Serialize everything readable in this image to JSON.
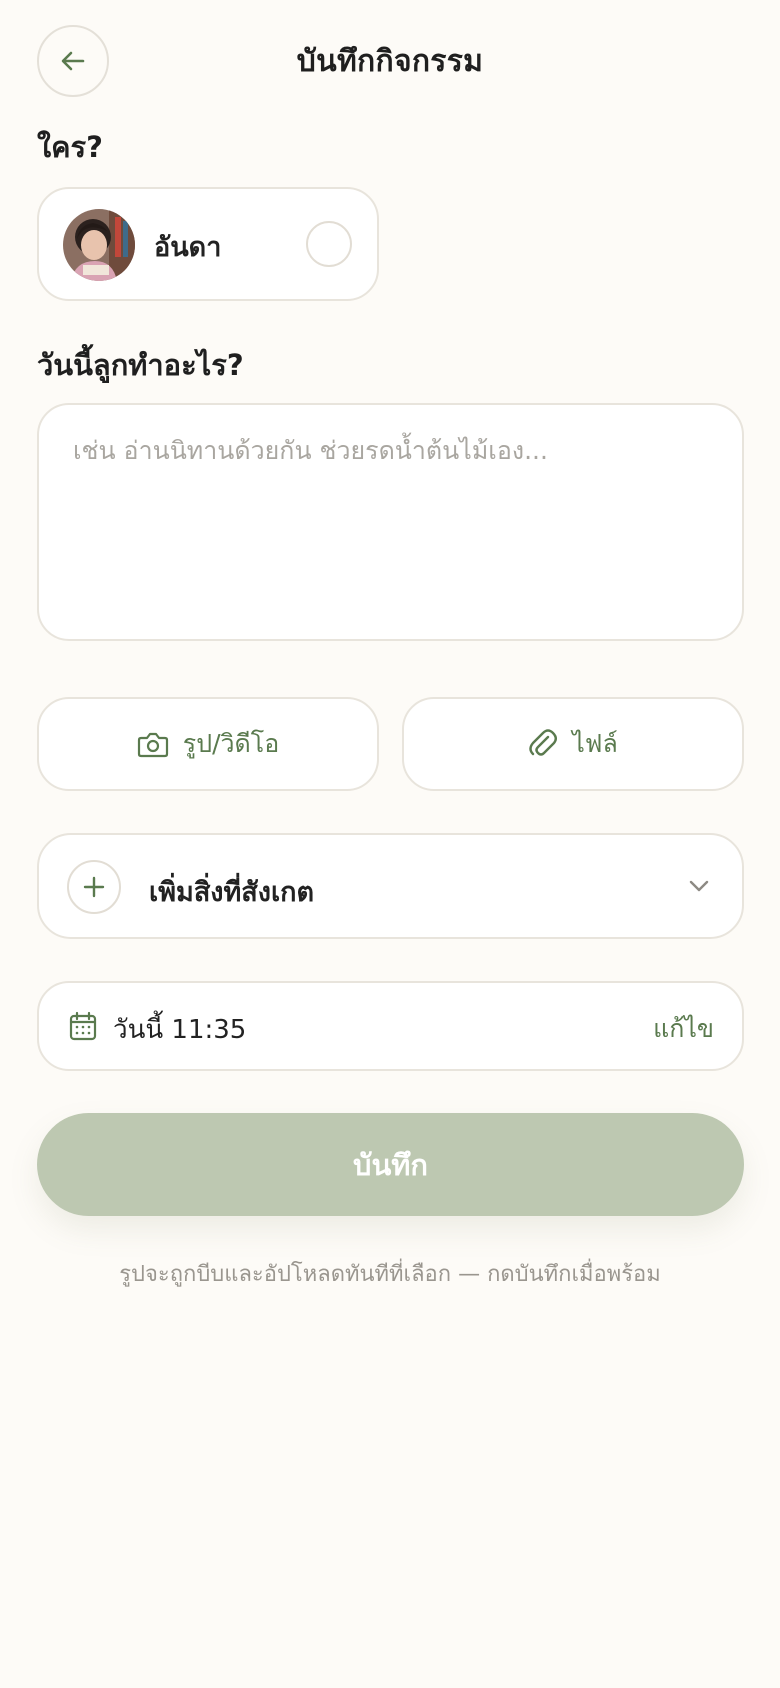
{
  "header": {
    "title": "บันทึกกิจกรรม",
    "back_icon": "arrow-left-icon"
  },
  "who": {
    "label": "ใคร?",
    "child": {
      "name": "อันดา",
      "selected": false
    }
  },
  "activity": {
    "label": "วันนี้ลูกทำอะไร?",
    "value": "",
    "placeholder": "เช่น อ่านนิทานด้วยกัน ช่วยรดน้ำต้นไม้เอง..."
  },
  "attachments": {
    "media_label": "รูป/วิดีโอ",
    "media_icon": "camera-icon",
    "file_label": "ไฟล์",
    "file_icon": "paperclip-icon"
  },
  "observation": {
    "label": "เพิ่มสิ่งที่สังเกต",
    "icon": "plus-icon",
    "expand_icon": "chevron-down-icon"
  },
  "datetime": {
    "icon": "calendar-icon",
    "value": "วันนี้ 11:35",
    "edit_label": "แก้ไข"
  },
  "actions": {
    "save_label": "บันทึก",
    "save_enabled": false
  },
  "hint": "รูปจะถูกบีบและอัปโหลดทันทีที่เลือก — กดบันทึกเมื่อพร้อม",
  "colors": {
    "background": "#fdfbf7",
    "accent": "#5a7a4e",
    "save_disabled": "#bdc8b1",
    "border": "#e8e4dc"
  }
}
